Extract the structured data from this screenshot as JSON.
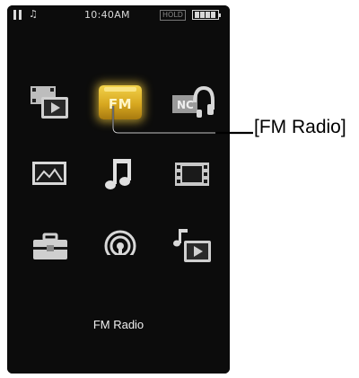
{
  "status_bar": {
    "time": "10:40AM",
    "hold_label": "HOLD",
    "note_glyph": "♫",
    "battery_level": 1.0
  },
  "home_menu": {
    "items": [
      {
        "name": "video-player-icon",
        "selected": false
      },
      {
        "name": "fm-radio-icon",
        "label": "FM",
        "selected": true
      },
      {
        "name": "noise-canceling-icon",
        "label": "NC",
        "selected": false
      },
      {
        "name": "photo-icon",
        "selected": false
      },
      {
        "name": "music-icon",
        "selected": false
      },
      {
        "name": "video-icon",
        "selected": false
      },
      {
        "name": "settings-toolbox-icon",
        "selected": false
      },
      {
        "name": "podcast-icon",
        "selected": false
      },
      {
        "name": "playlist-icon",
        "selected": false
      }
    ],
    "selected_label": "FM Radio"
  },
  "callout": {
    "text": "[FM Radio]"
  },
  "colors": {
    "screen_bg": "#0c0c0c",
    "icon_gray": "#c8c8c8",
    "highlight_gold": "#e8c038"
  }
}
